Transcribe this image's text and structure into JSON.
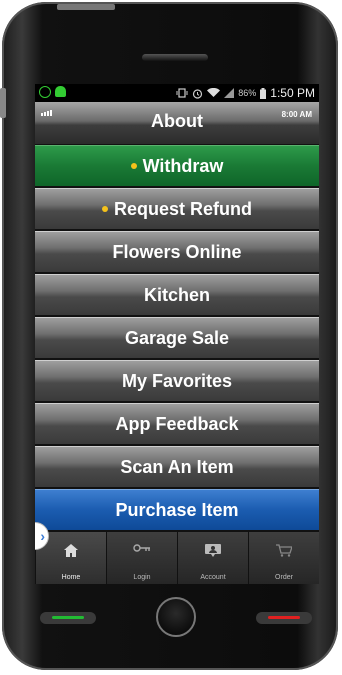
{
  "status_bar": {
    "battery_percent": "86%",
    "time": "1:50 PM",
    "icons": [
      "alarm-ring-icon",
      "android-icon",
      "vibrate-icon",
      "alarm-clock-icon",
      "wifi-icon",
      "signal-icon",
      "battery-icon"
    ]
  },
  "header": {
    "title": "About",
    "time": "8:00 AM"
  },
  "menu": {
    "items": [
      {
        "label": "Withdraw",
        "style": "green",
        "bullet": true
      },
      {
        "label": "Request Refund",
        "style": "gray",
        "bullet": true
      },
      {
        "label": "Flowers Online",
        "style": "gray",
        "bullet": false
      },
      {
        "label": "Kitchen",
        "style": "gray",
        "bullet": false
      },
      {
        "label": "Garage Sale",
        "style": "gray",
        "bullet": false
      },
      {
        "label": "My Favorites",
        "style": "gray",
        "bullet": false
      },
      {
        "label": "App Feedback",
        "style": "gray",
        "bullet": false
      },
      {
        "label": "Scan An Item",
        "style": "gray",
        "bullet": false
      },
      {
        "label": "Purchase Item",
        "style": "blue",
        "bullet": false
      }
    ]
  },
  "tabbar": {
    "tabs": [
      {
        "label": "Home",
        "icon": "home-icon",
        "active": true
      },
      {
        "label": "Login",
        "icon": "key-icon",
        "active": false
      },
      {
        "label": "Account",
        "icon": "account-icon",
        "active": false
      },
      {
        "label": "Order",
        "icon": "cart-icon",
        "active": false
      }
    ]
  },
  "drawer_handle": {
    "glyph": "›"
  },
  "colors": {
    "green_accent": "#1a7a35",
    "blue_accent": "#1b5cb0",
    "bullet": "#f5c21b",
    "call_green": "#22bb33",
    "end_red": "#e02020"
  }
}
